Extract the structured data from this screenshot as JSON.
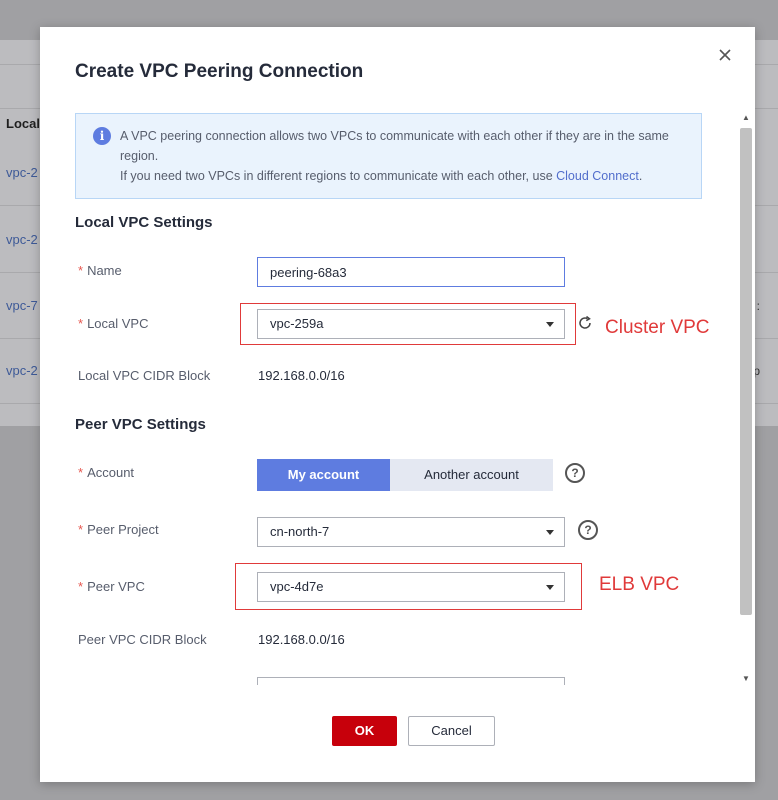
{
  "background": {
    "header_cell": "Local",
    "rows": [
      "vpc-2",
      "vpc-2",
      "vpc-7",
      "vpc-2"
    ],
    "right_frag_1": ":",
    "right_frag_2": "p"
  },
  "dialog": {
    "title": "Create VPC Peering Connection",
    "info": {
      "line1": "A VPC peering connection allows two VPCs to communicate with each other if they are in the same region.",
      "line2_prefix": "If you need two VPCs in different regions to communicate with each other, use ",
      "link": "Cloud Connect",
      "line2_suffix": "."
    },
    "local_section": {
      "title": "Local VPC Settings",
      "name_label": "Name",
      "name_value": "peering-68a3",
      "local_vpc_label": "Local VPC",
      "local_vpc_value": "vpc-259a",
      "cidr_label": "Local VPC CIDR Block",
      "cidr_value": "192.168.0.0/16"
    },
    "peer_section": {
      "title": "Peer VPC Settings",
      "account_label": "Account",
      "account_options": [
        "My account",
        "Another account"
      ],
      "account_selected": "My account",
      "project_label": "Peer Project",
      "project_value": "cn-north-7",
      "peer_vpc_label": "Peer VPC",
      "peer_vpc_value": "vpc-4d7e",
      "cidr_label": "Peer VPC CIDR Block",
      "cidr_value": "192.168.0.0/16"
    },
    "annotations": {
      "local": "Cluster VPC",
      "peer": "ELB VPC"
    },
    "buttons": {
      "ok": "OK",
      "cancel": "Cancel"
    },
    "colors": {
      "primary": "#5e7ce0",
      "danger_button": "#c7000b",
      "annotation": "#e03a3a",
      "info_bg": "#eaf3fd"
    },
    "icons": {
      "info": "info-icon",
      "close": "close-icon",
      "refresh": "refresh-icon",
      "help": "question-circle-icon",
      "caret": "caret-down-icon"
    }
  }
}
